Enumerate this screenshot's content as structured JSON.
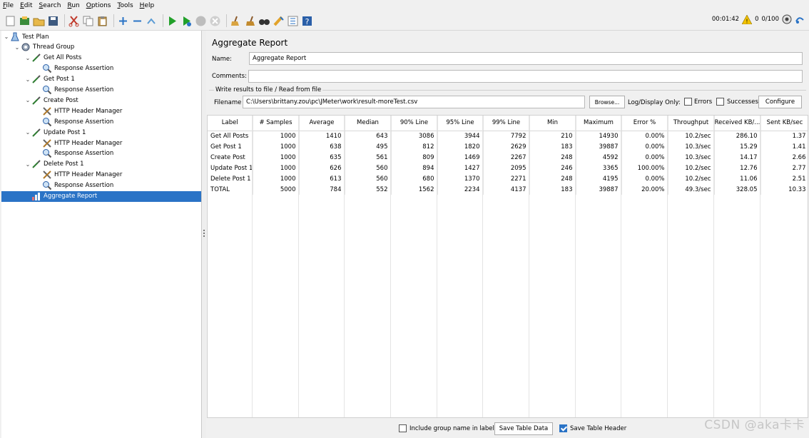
{
  "menu": [
    {
      "key": "F",
      "rest": "ile"
    },
    {
      "key": "E",
      "rest": "dit"
    },
    {
      "key": "S",
      "rest": "earch"
    },
    {
      "key": "R",
      "rest": "un"
    },
    {
      "key": "O",
      "rest": "ptions"
    },
    {
      "key": "T",
      "rest": "ools"
    },
    {
      "key": "H",
      "rest": "elp"
    }
  ],
  "status": {
    "timer": "00:01:42",
    "warnings": "0",
    "threads": "0/100"
  },
  "tree": [
    {
      "label": "Test Plan",
      "icon": "test-plan-icon",
      "level": 0,
      "expanded": true
    },
    {
      "label": "Thread Group",
      "icon": "thread-group-gear-icon",
      "level": 1,
      "expanded": true
    },
    {
      "label": "Get All Posts",
      "icon": "http-sampler-pipette-icon",
      "level": 2,
      "expanded": true
    },
    {
      "label": "Response Assertion",
      "icon": "magnifier-icon",
      "level": 3
    },
    {
      "label": "Get Post 1",
      "icon": "http-sampler-pipette-icon",
      "level": 2,
      "expanded": true
    },
    {
      "label": "Response Assertion",
      "icon": "magnifier-icon",
      "level": 3
    },
    {
      "label": "Create Post",
      "icon": "http-sampler-pipette-icon",
      "level": 2,
      "expanded": true
    },
    {
      "label": "HTTP Header Manager",
      "icon": "tools-cross-icon",
      "level": 3
    },
    {
      "label": "Response Assertion",
      "icon": "magnifier-icon",
      "level": 3
    },
    {
      "label": "Update Post 1",
      "icon": "http-sampler-pipette-icon",
      "level": 2,
      "expanded": true
    },
    {
      "label": "HTTP Header Manager",
      "icon": "tools-cross-icon",
      "level": 3
    },
    {
      "label": "Response Assertion",
      "icon": "magnifier-icon",
      "level": 3
    },
    {
      "label": "Delete Post 1",
      "icon": "http-sampler-pipette-icon",
      "level": 2,
      "expanded": true
    },
    {
      "label": "HTTP Header Manager",
      "icon": "tools-cross-icon",
      "level": 3
    },
    {
      "label": "Response Assertion",
      "icon": "magnifier-icon",
      "level": 3
    },
    {
      "label": "Aggregate Report",
      "icon": "chart-icon",
      "level": 2,
      "selected": true
    }
  ],
  "panel": {
    "title": "Aggregate Report",
    "name_label": "Name:",
    "name_value": "Aggregate Report",
    "comments_label": "Comments:",
    "comments_value": "",
    "fileset_label": "Write results to file / Read from file",
    "filename_label": "Filename",
    "filename_value": "C:\\Users\\brittany.zou\\pc\\JMeter\\work\\result-moreTest.csv",
    "browse_label": "Browse...",
    "log_display_label": "Log/Display Only:",
    "errors_label": "Errors",
    "successes_label": "Successes",
    "configure_label": "Configure"
  },
  "table": {
    "headers": [
      "Label",
      "# Samples",
      "Average",
      "Median",
      "90% Line",
      "95% Line",
      "99% Line",
      "Min",
      "Maximum",
      "Error %",
      "Throughput",
      "Received KB/...",
      "Sent KB/sec"
    ],
    "rows": [
      [
        "Get All Posts",
        "1000",
        "1410",
        "643",
        "3086",
        "3944",
        "7792",
        "210",
        "14930",
        "0.00%",
        "10.2/sec",
        "286.10",
        "1.37"
      ],
      [
        "Get Post 1",
        "1000",
        "638",
        "495",
        "812",
        "1820",
        "2629",
        "183",
        "39887",
        "0.00%",
        "10.3/sec",
        "15.29",
        "1.41"
      ],
      [
        "Create Post",
        "1000",
        "635",
        "561",
        "809",
        "1469",
        "2267",
        "248",
        "4592",
        "0.00%",
        "10.3/sec",
        "14.17",
        "2.66"
      ],
      [
        "Update Post 1",
        "1000",
        "626",
        "560",
        "894",
        "1427",
        "2095",
        "246",
        "3365",
        "100.00%",
        "10.2/sec",
        "12.76",
        "2.77"
      ],
      [
        "Delete Post 1",
        "1000",
        "613",
        "560",
        "680",
        "1370",
        "2271",
        "248",
        "4195",
        "0.00%",
        "10.2/sec",
        "11.06",
        "2.51"
      ],
      [
        "TOTAL",
        "5000",
        "784",
        "552",
        "1562",
        "2234",
        "4137",
        "183",
        "39887",
        "20.00%",
        "49.3/sec",
        "328.05",
        "10.33"
      ]
    ]
  },
  "bottom": {
    "include_group_label": "Include group name in label?",
    "include_group_checked": false,
    "save_table_data_label": "Save Table Data",
    "save_table_header_label": "Save Table Header",
    "save_table_header_checked": true
  },
  "watermark": "CSDN @aka卡卡"
}
